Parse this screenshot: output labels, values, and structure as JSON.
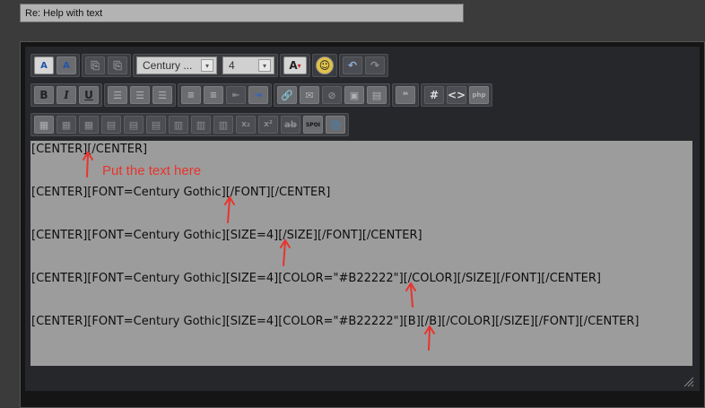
{
  "title_field": {
    "value": "Re: Help with text"
  },
  "toolbar": {
    "font_select": "Century ...",
    "size_select": "4",
    "buttons_row2": [
      "B",
      "I",
      "U"
    ]
  },
  "editor": {
    "lines": [
      "[CENTER][/CENTER]",
      "[CENTER][FONT=Century Gothic][/FONT][/CENTER]",
      "[CENTER][FONT=Century Gothic][SIZE=4][/SIZE][/FONT][/CENTER]",
      "[CENTER][FONT=Century Gothic][SIZE=4][COLOR=\"#B22222\"][/COLOR][/SIZE][/FONT][/CENTER]",
      "[CENTER][FONT=Century Gothic][SIZE=4][COLOR=\"#B22222\"][B][/B][/COLOR][/SIZE][/FONT][/CENTER]"
    ],
    "annotation": "Put the text here"
  },
  "colors": {
    "annotation": "#e8342c",
    "editor_bg": "#9c9c9c"
  }
}
